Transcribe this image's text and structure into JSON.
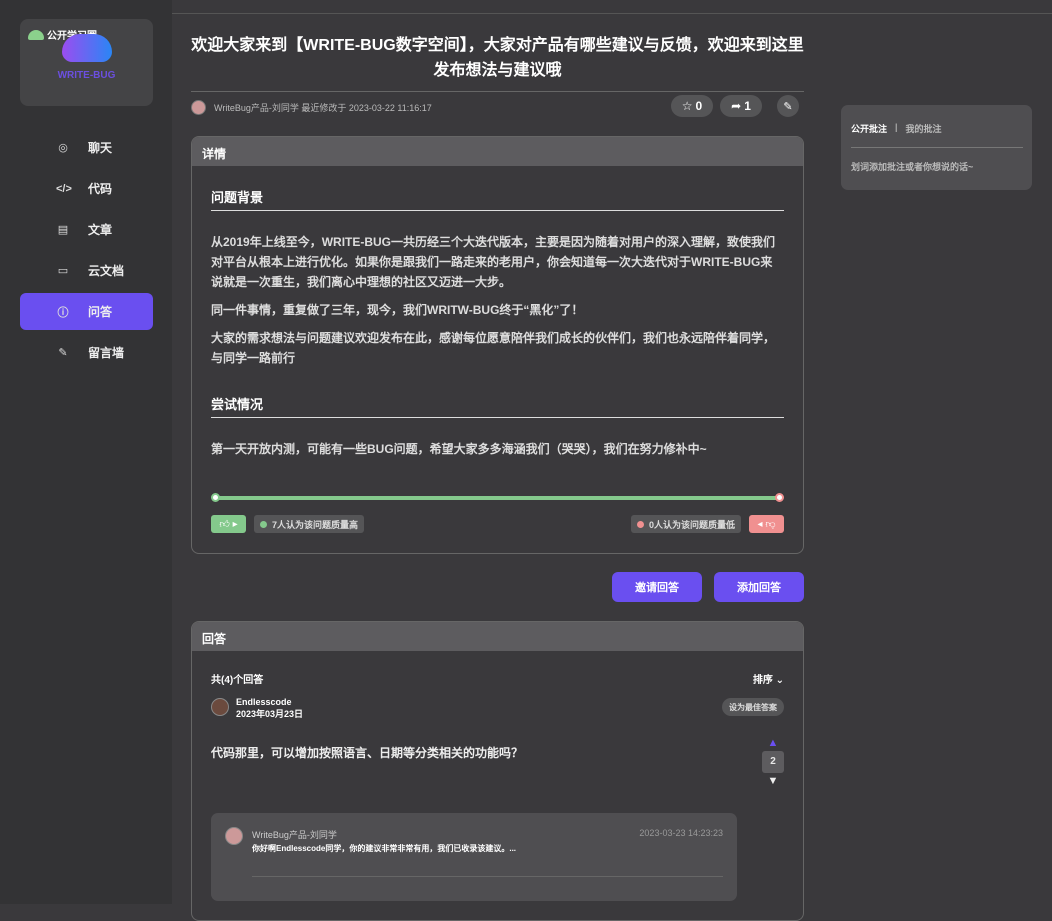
{
  "sidebar": {
    "logo_tag": "公开学习圈",
    "brand": "WRITE-BUG",
    "items": [
      {
        "label": "聊天",
        "icon": "chat-icon"
      },
      {
        "label": "代码",
        "icon": "code-icon"
      },
      {
        "label": "文章",
        "icon": "article-icon"
      },
      {
        "label": "云文档",
        "icon": "folder-icon"
      },
      {
        "label": "问答",
        "icon": "question-icon"
      },
      {
        "label": "留言墙",
        "icon": "edit-icon"
      }
    ],
    "active": 4
  },
  "post": {
    "title": "欢迎大家来到【WRITE-BUG数字空间】，大家对产品有哪些建议与反馈，欢迎来到这里发布想法与建议哦",
    "meta": "WriteBug产品-刘同学 最近修改于 2023-03-22 11:16:17",
    "stars": "0",
    "shares": "1"
  },
  "details": {
    "header": "详情",
    "section1": "问题背景",
    "p1": "从2019年上线至今，WRITE-BUG一共历经三个大迭代版本，主要是因为随着对用户的深入理解，致使我们对平台从根本上进行优化。如果你是跟我们一路走来的老用户，你会知道每一次大迭代对于WRITE-BUG来说就是一次重生，我们离心中理想的社区又迈进一大步。",
    "p2": "同一件事情，重复做了三年，现今，我们WRITW-BUG终于“黑化”了！",
    "p3": "大家的需求想法与问题建议欢迎发布在此，感谢每位愿意陪伴我们成长的伙伴们，我们也永远陪伴着同学，与同学一路前行",
    "section2": "尝试情况",
    "p4": "第一天开放内测，可能有一些BUG问题，希望大家多多海涵我们（哭哭），我们在努力修补中~",
    "quality_high": "7人认为该问题质量高",
    "quality_low": "0人认为该问题质量低",
    "high_fraction": 1.0
  },
  "actions": {
    "invite": "邀请回答",
    "add": "添加回答"
  },
  "answers": {
    "header": "回答",
    "count": "共(4)个回答",
    "sort": "排序",
    "items": [
      {
        "user": "Endlesscode",
        "date": "2023年03月23日",
        "best_label": "设为最佳答案",
        "text": "代码那里，可以增加按照语言、日期等分类相关的功能吗？",
        "votes": "2",
        "reply": {
          "user": "WriteBug产品-刘同学",
          "time": "2023-03-23 14:23:23",
          "text": "你好啊Endlesscode同学，你的建议非常非常有用，我们已收录该建议。..."
        }
      }
    ]
  },
  "annotations": {
    "tab_public": "公开批注",
    "sep": "|",
    "tab_mine": "我的批注",
    "placeholder": "划词添加批注或者你想说的话~"
  }
}
